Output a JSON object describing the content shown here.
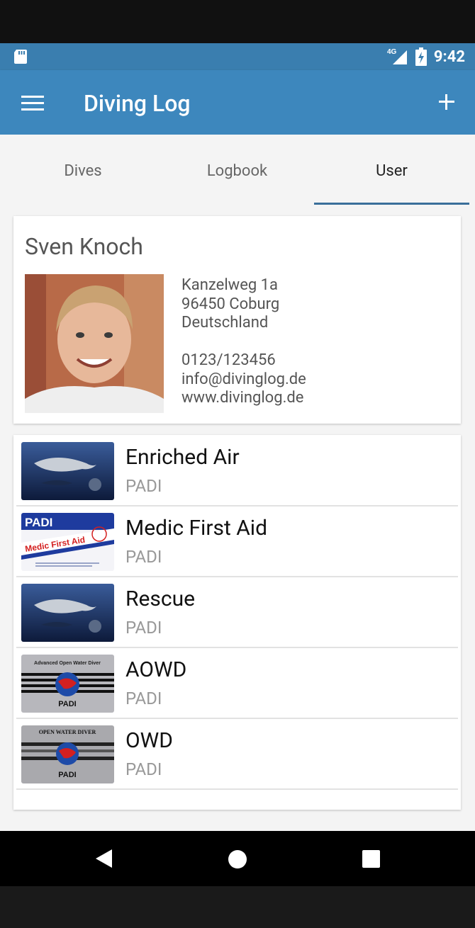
{
  "status_bar": {
    "network": "4G",
    "time": "9:42",
    "icons": [
      "sd-card-icon",
      "signal-icon",
      "battery-icon"
    ]
  },
  "toolbar": {
    "title": "Diving Log",
    "menu_icon": "hamburger-menu-icon",
    "add_icon": "plus-icon"
  },
  "tabs": [
    {
      "label": "Dives",
      "active": false
    },
    {
      "label": "Logbook",
      "active": false
    },
    {
      "label": "User",
      "active": true
    }
  ],
  "user": {
    "name": "Sven Knoch",
    "address_lines": [
      "Kanzelweg 1a",
      "96450 Coburg",
      "Deutschland"
    ],
    "phone": "0123/123456",
    "email": "info@divinglog.de",
    "website": "www.divinglog.de"
  },
  "certifications": [
    {
      "name": "Enriched Air",
      "org": "PADI",
      "card": "dolphin"
    },
    {
      "name": "Medic First Aid",
      "org": "PADI",
      "card": "medic"
    },
    {
      "name": "Rescue",
      "org": "PADI",
      "card": "dolphin"
    },
    {
      "name": "AOWD",
      "org": "PADI",
      "card": "aowd"
    },
    {
      "name": "OWD",
      "org": "PADI",
      "card": "owd"
    }
  ],
  "card_text": {
    "medic_padi": "PADI",
    "medic_title": "Medic First Aid",
    "aowd_header": "Advanced Open Water Diver",
    "owd_header": "OPEN WATER DIVER",
    "padi_mark": "PADI"
  },
  "colors": {
    "status_bar": "#3a7eaf",
    "toolbar": "#3d87bd",
    "tab_indicator": "#3a6f9a",
    "background": "#f4f4f4"
  },
  "nav_bar": {
    "back_icon": "back-triangle-icon",
    "home_icon": "home-circle-icon",
    "recents_icon": "recents-square-icon"
  }
}
